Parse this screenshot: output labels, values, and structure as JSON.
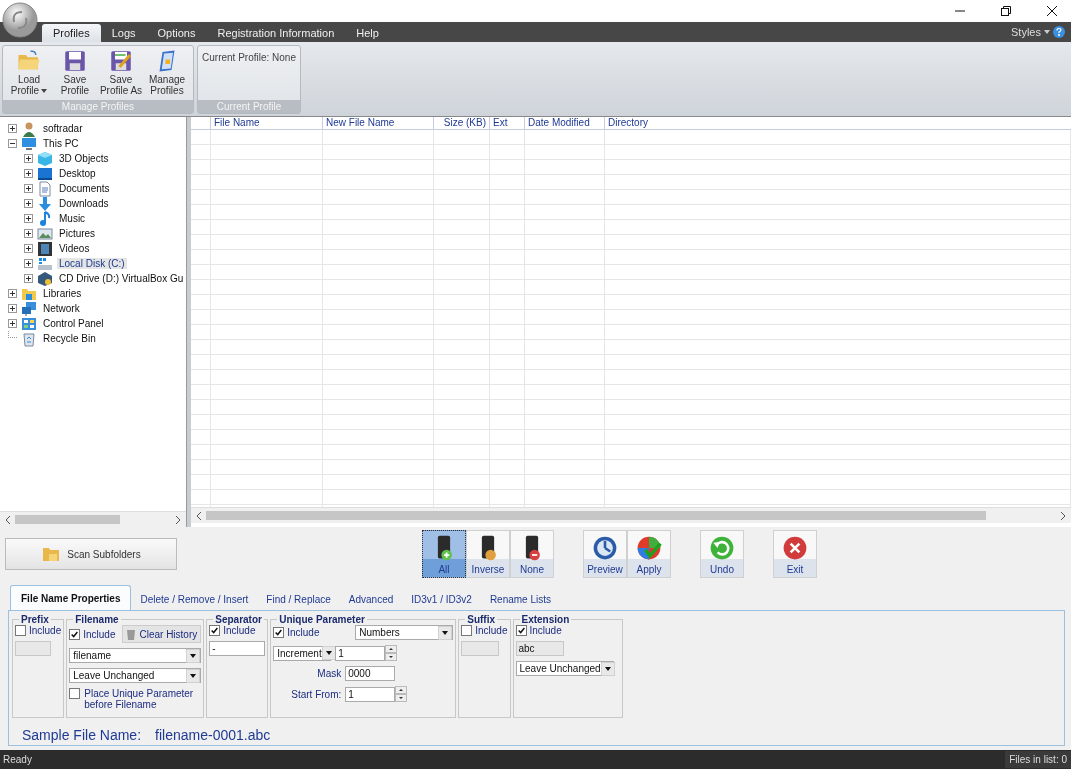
{
  "ribbon": {
    "tabs": [
      {
        "label": "Profiles",
        "selected": true
      },
      {
        "label": "Logs",
        "selected": false
      },
      {
        "label": "Options",
        "selected": false
      },
      {
        "label": "Registration Information",
        "selected": false
      },
      {
        "label": "Help",
        "selected": false
      }
    ],
    "styles": "Styles",
    "groups": [
      {
        "title": "Manage Profiles",
        "buttons": [
          {
            "kind": "load",
            "label": "Load Profile",
            "dropdown": true
          },
          {
            "kind": "save",
            "label": "Save Profile",
            "dropdown": false
          },
          {
            "kind": "save-as",
            "label": "Save Profile As",
            "dropdown": false
          },
          {
            "kind": "manage",
            "label": "Manage Profiles",
            "dropdown": false
          }
        ]
      },
      {
        "title": "Current Profile",
        "text": "Current Profile: None"
      }
    ]
  },
  "tree": [
    {
      "label": "softradar",
      "kind": "user",
      "expanded": false,
      "selected": false
    },
    {
      "label": "This PC",
      "kind": "computer",
      "expanded": true,
      "selected": false,
      "children": [
        {
          "label": "3D Objects",
          "kind": "objects",
          "expanded": false,
          "selected": false
        },
        {
          "label": "Desktop",
          "kind": "desktop",
          "expanded": false,
          "selected": false
        },
        {
          "label": "Documents",
          "kind": "documents",
          "expanded": false,
          "selected": false
        },
        {
          "label": "Downloads",
          "kind": "downloads",
          "expanded": false,
          "selected": false
        },
        {
          "label": "Music",
          "kind": "music",
          "expanded": false,
          "selected": false
        },
        {
          "label": "Pictures",
          "kind": "pictures",
          "expanded": false,
          "selected": false
        },
        {
          "label": "Videos",
          "kind": "videos",
          "expanded": false,
          "selected": false
        },
        {
          "label": "Local Disk (C:)",
          "kind": "drive",
          "expanded": false,
          "selected": true
        },
        {
          "label": "CD Drive (D:) VirtualBox Gu",
          "kind": "cd",
          "expanded": false,
          "selected": false
        }
      ]
    },
    {
      "label": "Libraries",
      "kind": "libraries",
      "expanded": false,
      "selected": false
    },
    {
      "label": "Network",
      "kind": "network",
      "expanded": false,
      "selected": false
    },
    {
      "label": "Control Panel",
      "kind": "control-panel",
      "expanded": false,
      "selected": false
    },
    {
      "label": "Recycle Bin",
      "kind": "recycle-bin",
      "selected": false
    }
  ],
  "table": {
    "columns": [
      "File Name",
      "New File Name",
      "Size (KB)",
      "Ext",
      "Date Modified",
      "Directory"
    ]
  },
  "scan_button": "Scan Subfolders",
  "toolbar": [
    [
      {
        "kind": "all",
        "label": "All",
        "selected": true
      },
      {
        "kind": "inverse",
        "label": "Inverse",
        "selected": false
      },
      {
        "kind": "none",
        "label": "None",
        "selected": false
      }
    ],
    [
      {
        "kind": "preview",
        "label": "Preview",
        "selected": false
      },
      {
        "kind": "apply",
        "label": "Apply",
        "selected": false
      }
    ],
    [
      {
        "kind": "undo",
        "label": "Undo",
        "selected": false
      }
    ],
    [
      {
        "kind": "exit",
        "label": "Exit",
        "selected": false
      }
    ]
  ],
  "tabs": [
    {
      "label": "File Name Properties",
      "selected": true
    },
    {
      "label": "Delete / Remove / Insert",
      "selected": false
    },
    {
      "label": "Find / Replace",
      "selected": false
    },
    {
      "label": "Advanced",
      "selected": false
    },
    {
      "label": "ID3v1 / ID3v2",
      "selected": false
    },
    {
      "label": "Rename Lists",
      "selected": false
    }
  ],
  "prefix": {
    "title": "Prefix",
    "include": {
      "label": "Include",
      "checked": false
    },
    "field": {
      "disabled": true
    }
  },
  "filename": {
    "title": "Filename",
    "include": {
      "label": "Include",
      "checked": true
    },
    "clear_history": "Clear History",
    "name_dropdown": "filename",
    "case_dropdown": "Leave Unchanged",
    "place_before": {
      "label": "Place Unique Parameter before Filename",
      "checked": false
    }
  },
  "separator": {
    "title": "Separator",
    "include": {
      "label": "Include",
      "checked": true
    },
    "value": "-"
  },
  "unique": {
    "title": "Unique Parameter",
    "include": {
      "label": "Include",
      "checked": true
    },
    "type_dropdown": "Numbers",
    "mode_dropdown": "Increment",
    "step": "1",
    "mask_label": "Mask",
    "mask": "0000",
    "start_label": "Start From:",
    "start": "1"
  },
  "suffix": {
    "title": "Suffix",
    "include": {
      "label": "Include",
      "checked": false
    },
    "field": {
      "disabled": true
    }
  },
  "extension": {
    "title": "Extension",
    "include": {
      "label": "Include",
      "checked": true
    },
    "value": "abc",
    "disabled": true,
    "case_dropdown": "Leave Unchanged"
  },
  "sample": {
    "label": "Sample File Name:",
    "value": "filename-0001.abc"
  },
  "status_bar": {
    "left": "Ready",
    "right": "Files in list: 0"
  }
}
